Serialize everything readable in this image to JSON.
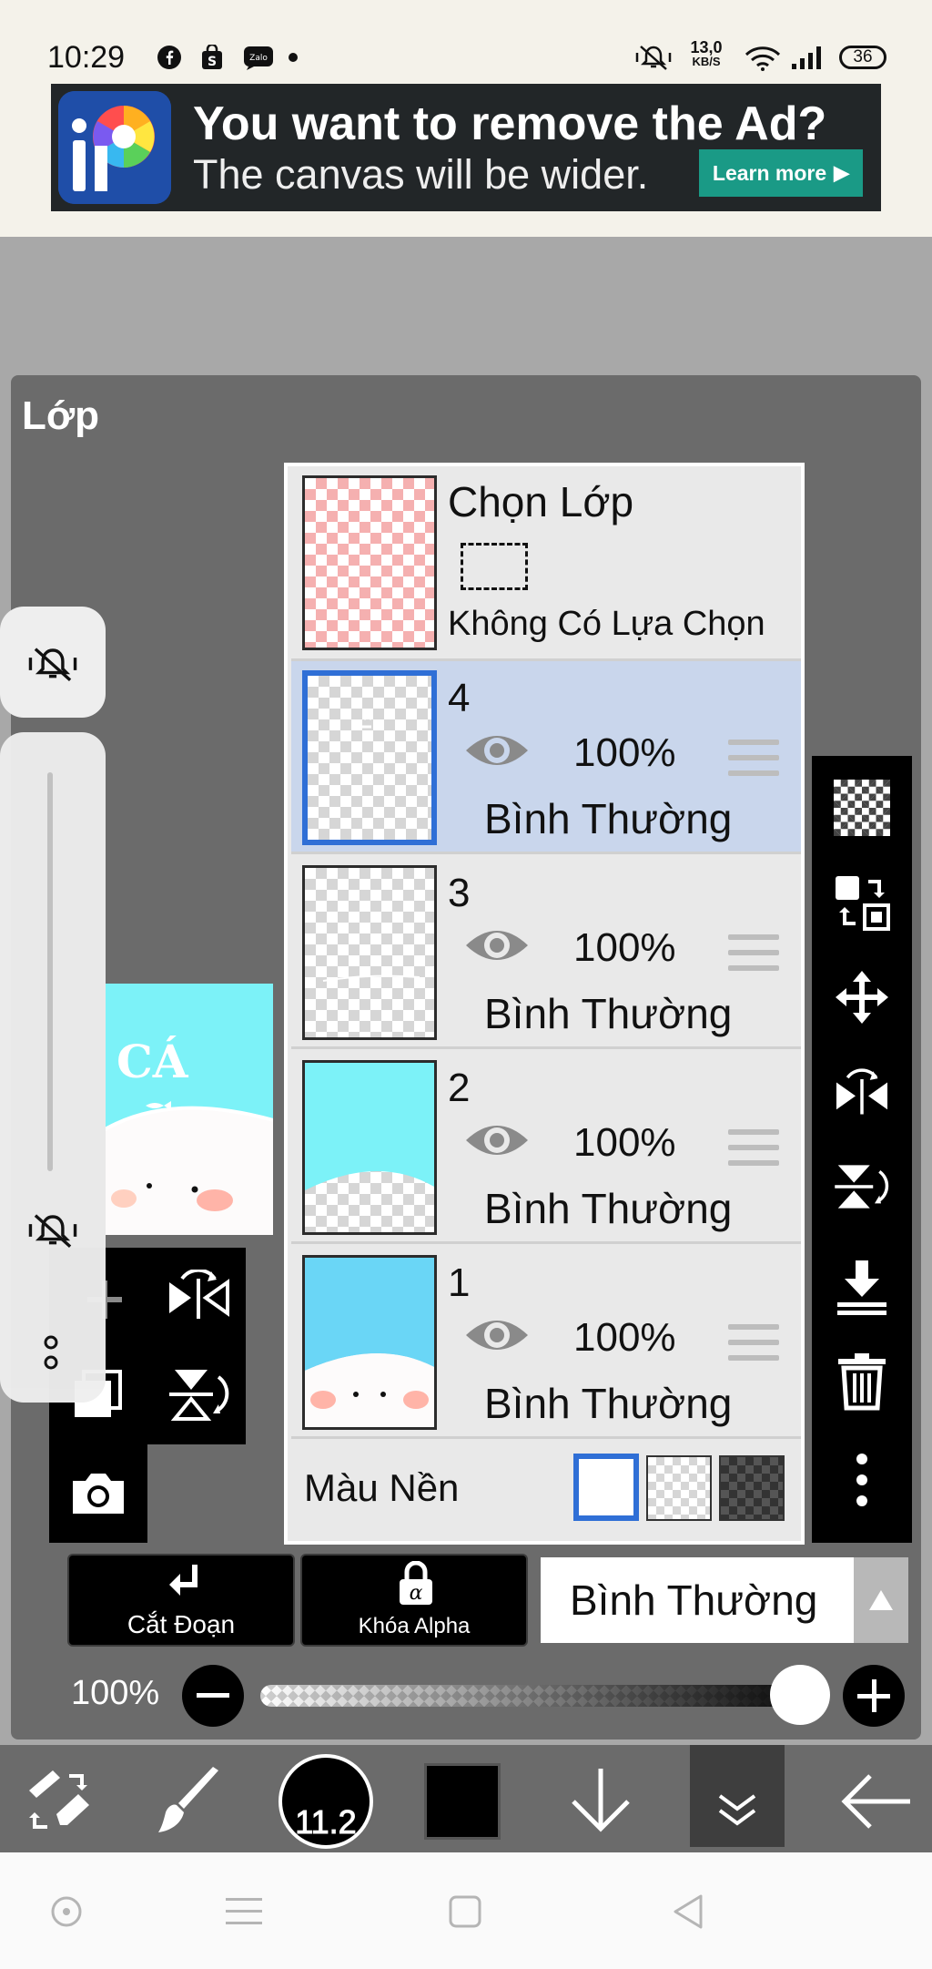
{
  "status_bar": {
    "time": "10:29",
    "network_speed": "13,0",
    "network_unit": "KB/S",
    "battery": "36"
  },
  "ad": {
    "headline": "You want to remove the Ad?",
    "subline": "The canvas will be wider.",
    "cta": "Learn more"
  },
  "panel": {
    "title": "Lớp"
  },
  "artwork": {
    "text": "CÁ"
  },
  "selection_row": {
    "title": "Chọn Lớp",
    "status": "Không Có Lựa Chọn"
  },
  "layers": [
    {
      "number": "4",
      "opacity": "100%",
      "blend": "Bình Thường",
      "selected": true
    },
    {
      "number": "3",
      "opacity": "100%",
      "blend": "Bình Thường",
      "selected": false
    },
    {
      "number": "2",
      "opacity": "100%",
      "blend": "Bình Thường",
      "selected": false
    },
    {
      "number": "1",
      "opacity": "100%",
      "blend": "Bình Thường",
      "selected": false
    }
  ],
  "background": {
    "label": "Màu Nền",
    "options": [
      "white",
      "transparent",
      "dark-checker"
    ],
    "selected": "white"
  },
  "actions": {
    "clip_label": "Cắt Đoạn",
    "alpha_lock_label": "Khóa Alpha",
    "blend_mode": "Bình Thường"
  },
  "opacity": {
    "label": "100%",
    "value": 1.0
  },
  "toolbar": {
    "brush_size": "11.2",
    "color": "#000000"
  },
  "colors": {
    "accent": "#2f6fd6",
    "selected_row": "#c9d6ec",
    "ad_button": "#1a9a86",
    "panel": "#6b6b6b"
  }
}
